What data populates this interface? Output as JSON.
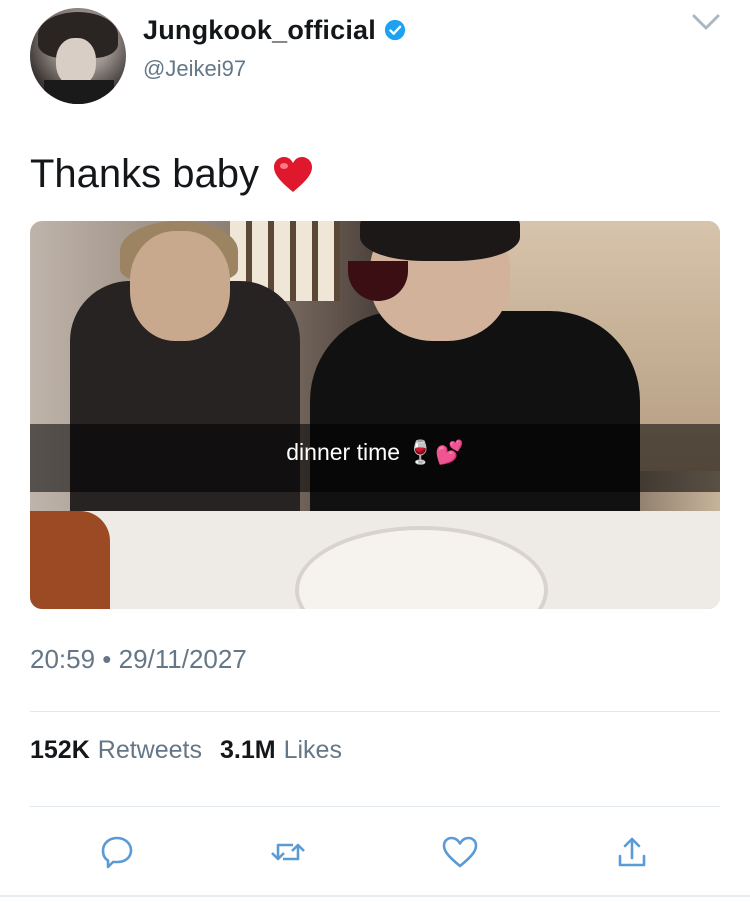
{
  "user": {
    "name": "Jungkook_official",
    "handle": "@Jeikei97",
    "verified": true,
    "avatar_icon": "profile-photo"
  },
  "tweet": {
    "text": "Thanks baby",
    "emoji": "red-heart-emoji",
    "photo_caption": "dinner time 🍷💕",
    "timestamp": "20:59 • 29/11/2027"
  },
  "stats": {
    "retweets_count": "152K",
    "retweets_label": "Retweets",
    "likes_count": "3.1M",
    "likes_label": "Likes"
  },
  "actions": [
    "reply-icon",
    "retweet-icon",
    "like-icon",
    "share-icon"
  ],
  "colors": {
    "verified_blue": "#1da1f2",
    "secondary_text": "#657786",
    "icon_blue": "#5b9bd5",
    "heart_red": "#e0245e"
  }
}
